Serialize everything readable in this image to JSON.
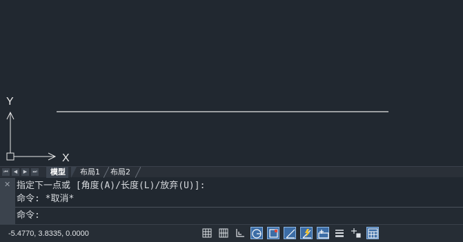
{
  "viewport": {
    "axis_x_label": "X",
    "axis_y_label": "Y"
  },
  "layout_tabs": {
    "nav_first": "⏮",
    "nav_prev": "◀",
    "nav_next": "▶",
    "nav_last": "⏭",
    "tabs": [
      {
        "label": "模型",
        "active": true
      },
      {
        "label": "布局1",
        "active": false
      },
      {
        "label": "布局2",
        "active": false
      }
    ]
  },
  "command_panel": {
    "close_glyph": "✕",
    "history": [
      "指定下一点或 [角度(A)/长度(L)/放弃(U)]:",
      "命令: *取消*"
    ],
    "prompt": "命令:"
  },
  "statusbar": {
    "coordinates": "-5.4770, 3.8335, 0.0000",
    "toggles": [
      {
        "icon": "grid-snap-icon",
        "on": false
      },
      {
        "icon": "grid-display-icon",
        "on": false
      },
      {
        "icon": "ortho-icon",
        "on": false
      },
      {
        "icon": "polar-tracking-icon",
        "on": true
      },
      {
        "icon": "object-snap-icon",
        "on": true
      },
      {
        "icon": "object-snap-tracking-icon",
        "on": true
      },
      {
        "icon": "dynamic-ucs-icon",
        "on": true
      },
      {
        "icon": "dynamic-input-icon",
        "on": true
      },
      {
        "icon": "lineweight-icon",
        "on": false
      },
      {
        "icon": "selection-cycling-icon",
        "on": false
      },
      {
        "icon": "quick-properties-icon",
        "on": true
      }
    ]
  }
}
